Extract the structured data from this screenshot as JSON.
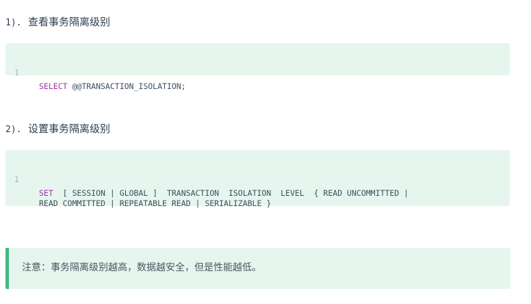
{
  "section1": {
    "number": "1).",
    "title": "查看事务隔离级别",
    "code": {
      "line_number": "1",
      "keyword": "SELECT",
      "rest": " @@TRANSACTION_ISOLATION;"
    }
  },
  "section2": {
    "number": "2).",
    "title": "设置事务隔离级别",
    "code": {
      "line_number": "1",
      "keyword": "SET",
      "rest_line1": "  [ SESSION | GLOBAL ]  TRANSACTION  ISOLATION  LEVEL  { READ UNCOMMITTED |",
      "rest_line2": "READ COMMITTED | REPEATABLE READ | SERIALIZABLE }"
    }
  },
  "note": {
    "text": "注意：事务隔离级别越高，数据越安全，但是性能越低。"
  },
  "colors": {
    "code_background": "#e6f6ee",
    "note_border": "#42b983",
    "keyword": "#9c2fa6",
    "line_number": "#a8b3bd",
    "text": "#2c3e50"
  }
}
